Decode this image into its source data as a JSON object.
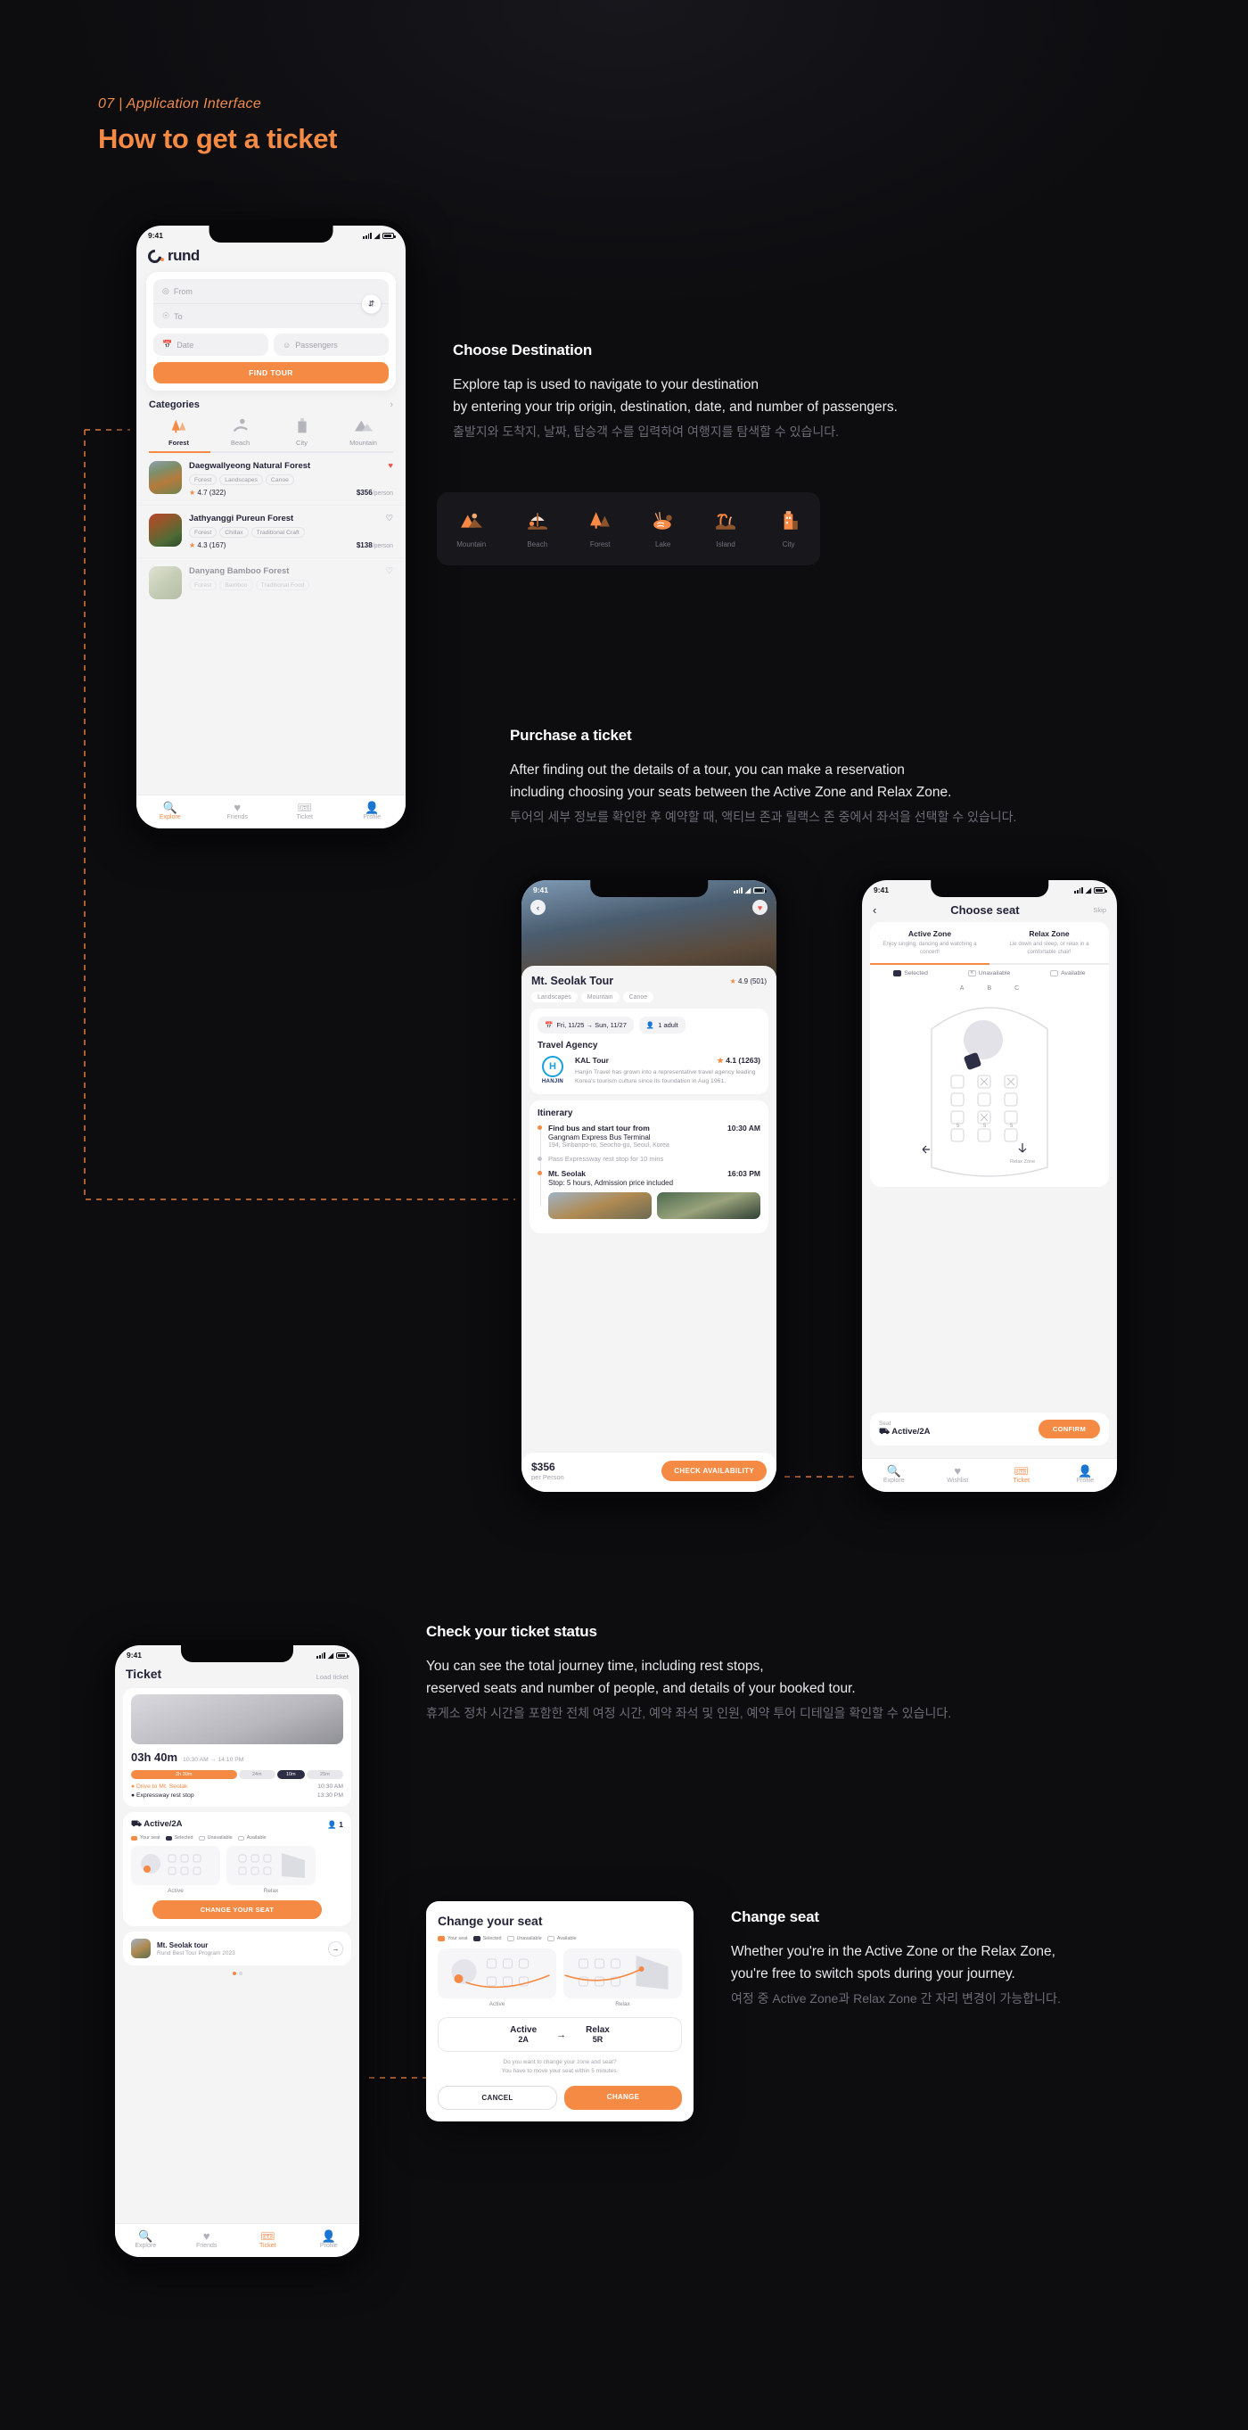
{
  "header": {
    "eyebrow": "07 | Application Interface",
    "title": "How to get a ticket"
  },
  "colors": {
    "accent": "#f58a45",
    "dark": "#0d0d10",
    "navy": "#242438"
  },
  "sections": [
    {
      "id": "choose-destination",
      "title": "Choose Destination",
      "line1": "Explore tap is used to navigate to your destination",
      "line2": "by entering your trip origin, destination, date, and number of passengers.",
      "kr": "출발지와 도착지, 날짜, 탑승객 수를 입력하여 여행지를 탐색할 수 있습니다."
    },
    {
      "id": "purchase-ticket",
      "title": "Purchase a ticket",
      "line1": "After finding out the details of a tour, you can make a reservation",
      "line2": "including choosing your seats between the Active Zone and Relax Zone.",
      "kr": "투어의 세부 정보를 확인한 후 예약할 때, 액티브 존과 릴랙스 존 중에서 좌석을 선택할 수 있습니다."
    },
    {
      "id": "ticket-status",
      "title": "Check your ticket status",
      "line1": "You can see the total journey time, including rest stops,",
      "line2": "reserved seats and number of people, and details of your booked tour.",
      "kr": "휴게소 정차 시간을 포함한 전체 여정 시간, 예약 좌석 및 인원, 예약 투어 디테일을 확인할 수 있습니다."
    },
    {
      "id": "change-seat",
      "title": "Change seat",
      "line1": "Whether you're in the Active Zone or the Relax Zone,",
      "line2": "you're free to switch spots during your journey.",
      "kr": "여정 중 Active Zone과 Relax Zone 간 자리 변경이 가능합니다."
    }
  ],
  "icon_strip": [
    {
      "name": "mountain-icon",
      "glyph": "⛰",
      "label": "Mountain"
    },
    {
      "name": "beach-icon",
      "glyph": "⛱",
      "label": "Beach"
    },
    {
      "name": "forest-icon",
      "glyph": "🌲",
      "label": "Forest"
    },
    {
      "name": "lake-icon",
      "glyph": "🏞",
      "label": "Lake"
    },
    {
      "name": "island-icon",
      "glyph": "🏝",
      "label": "Island"
    },
    {
      "name": "city-icon",
      "glyph": "🏙",
      "label": "City"
    }
  ],
  "phone_explore": {
    "status_time": "9:41",
    "brand": "rund",
    "search": {
      "from_placeholder": "From",
      "to_placeholder": "To",
      "date_placeholder": "Date",
      "passengers_placeholder": "Passengers",
      "swap_icon": "⇵",
      "find_button": "FIND TOUR"
    },
    "categories_title": "Categories",
    "categories": [
      {
        "label": "Forest",
        "glyph": "🌲",
        "active": true
      },
      {
        "label": "Beach",
        "glyph": "🏄",
        "active": false
      },
      {
        "label": "City",
        "glyph": "🏛",
        "active": false
      },
      {
        "label": "Mountain",
        "glyph": "⛰",
        "active": false
      }
    ],
    "tours": [
      {
        "name": "Daegwallyeong Natural Forest",
        "tags": [
          "Forest",
          "Landscapes",
          "Canoe"
        ],
        "rating": "4.7 (322)",
        "price": "$356",
        "unit": "/person",
        "fav": true
      },
      {
        "name": "Jathyanggi Pureun Forest",
        "tags": [
          "Forest",
          "Chillax",
          "Traditional Craft"
        ],
        "rating": "4.3 (167)",
        "price": "$138",
        "unit": "/person",
        "fav": false
      },
      {
        "name": "Danyang Bamboo Forest",
        "tags": [
          "Forest",
          "Bamboo",
          "Traditional Food"
        ],
        "rating": "",
        "price": "",
        "unit": "",
        "fav": false
      }
    ],
    "tabs": [
      {
        "label": "Explore",
        "glyph": "🔍",
        "active": true
      },
      {
        "label": "Friends",
        "glyph": "♥",
        "active": false
      },
      {
        "label": "Ticket",
        "glyph": "🎟",
        "active": false
      },
      {
        "label": "Profile",
        "glyph": "👤",
        "active": false
      }
    ]
  },
  "phone_tour": {
    "status_time": "9:41",
    "back_icon": "‹",
    "heart_icon": "♥",
    "title": "Mt. Seolak Tour",
    "rating": "4.9 (501)",
    "tags": [
      "Landscapes",
      "Mountain",
      "Canoe"
    ],
    "date_chip": "Fri, 11/25 → Sun, 11/27",
    "people_chip": "1 adult",
    "agency_heading": "Travel Agency",
    "agency": {
      "logo_letter": "H",
      "logo_name": "HANJIN",
      "name": "KAL Tour",
      "rating": "4.1 (1263)",
      "desc": "Hanjin Travel has grown into a representative travel agency leading Korea's tourism culture since its foundation in Aug 1961."
    },
    "itinerary_heading": "Itinerary",
    "itinerary": [
      {
        "title": "Find bus and start tour from",
        "time": "10:30 AM",
        "sub1": "Gangnam Express Bus Terminal",
        "sub2": "194, Sinbanpo-ro, Seocho-gu, Seoul, Korea",
        "muted": false
      },
      {
        "title": "Pass Expressway rest stop for 10 mins",
        "time": "",
        "sub1": "",
        "sub2": "",
        "muted": true
      },
      {
        "title": "Mt. Seolak",
        "time": "16:03 PM",
        "sub1": "Stop: 5 hours, Admission price included",
        "sub2": "",
        "muted": false
      }
    ],
    "price": "$356",
    "price_unit": "per Person",
    "cta": "CHECK AVAILABILITY"
  },
  "phone_seat": {
    "status_time": "9:41",
    "back_icon": "‹",
    "title": "Choose seat",
    "skip": "Skip",
    "zones": [
      {
        "title": "Active Zone",
        "desc": "Enjoy singing, dancing and watching a concert!",
        "active": true
      },
      {
        "title": "Relax Zone",
        "desc": "Lie down and sleep, or relax in a comfortable chair!",
        "active": false
      }
    ],
    "legend": [
      {
        "label": "Selected",
        "color": "#2d2d44"
      },
      {
        "label": "Unavailable",
        "color": "#ffffff"
      },
      {
        "label": "Available",
        "color": "#ffffff"
      }
    ],
    "columns": [
      "A",
      "B",
      "C"
    ],
    "zone_label_bottom": "Relax Zone",
    "selected_label": "Seat",
    "selected_seat": "Active/2A",
    "confirm": "CONFIRM",
    "tabs": [
      {
        "label": "Explore",
        "glyph": "🔍",
        "active": false
      },
      {
        "label": "Wishlist",
        "glyph": "♥",
        "active": false
      },
      {
        "label": "Ticket",
        "glyph": "🎟",
        "active": true
      },
      {
        "label": "Profile",
        "glyph": "👤",
        "active": false
      }
    ]
  },
  "phone_ticket": {
    "status_time": "9:41",
    "title": "Ticket",
    "load_ticket": "Load ticket",
    "duration": "03h 40m",
    "duration_sub": "10:30 AM → 14:10 PM",
    "segments": [
      {
        "label": "2h 30m",
        "color": "#f58a45",
        "flex": 46
      },
      {
        "label": "24m",
        "color": "#e8e8ec",
        "flex": 16
      },
      {
        "label": "10m",
        "color": "#2d2d44",
        "flex": 12
      },
      {
        "label": "25m",
        "color": "#e8e8ec",
        "flex": 16
      }
    ],
    "legs": [
      {
        "text": "Drive to Mt. Seolak",
        "time": "10:30 AM",
        "accent": true
      },
      {
        "text": "Expressway rest stop",
        "time": "13:30 PM",
        "accent": false
      }
    ],
    "seat_label": "Active/2A",
    "people": "1",
    "legend": [
      {
        "label": "Your seat",
        "color": "#f58a45"
      },
      {
        "label": "Selected",
        "color": "#2d2d44"
      },
      {
        "label": "Unavailable",
        "color": "#ffffff"
      },
      {
        "label": "Available",
        "color": "#ffffff"
      }
    ],
    "map_labels": [
      "Active",
      "Relax"
    ],
    "change_button": "CHANGE YOUR SEAT",
    "booked": {
      "name": "Mt. Seolak tour",
      "sub": "Rund Best Tour Program 2023",
      "arrow": "→"
    },
    "tabs": [
      {
        "label": "Explore",
        "glyph": "🔍",
        "active": false
      },
      {
        "label": "Friends",
        "glyph": "♥",
        "active": false
      },
      {
        "label": "Ticket",
        "glyph": "🎟",
        "active": true
      },
      {
        "label": "Profile",
        "glyph": "👤",
        "active": false
      }
    ]
  },
  "modal_change_seat": {
    "title": "Change your seat",
    "legend": [
      {
        "label": "Your seat",
        "color": "#f58a45"
      },
      {
        "label": "Selected",
        "color": "#2d2d44"
      },
      {
        "label": "Unavailable",
        "color": "#ffffff"
      },
      {
        "label": "Available",
        "color": "#ffffff"
      }
    ],
    "map_labels": [
      "Active",
      "Relax"
    ],
    "from_label": "Active",
    "from_value": "2A",
    "arrow": "→",
    "to_label": "Relax",
    "to_value": "5R",
    "note1": "Do you want to change your zone and seat?",
    "note2": "You have to move your seat within 5 minutes.",
    "cancel": "CANCEL",
    "confirm": "CHANGE"
  }
}
